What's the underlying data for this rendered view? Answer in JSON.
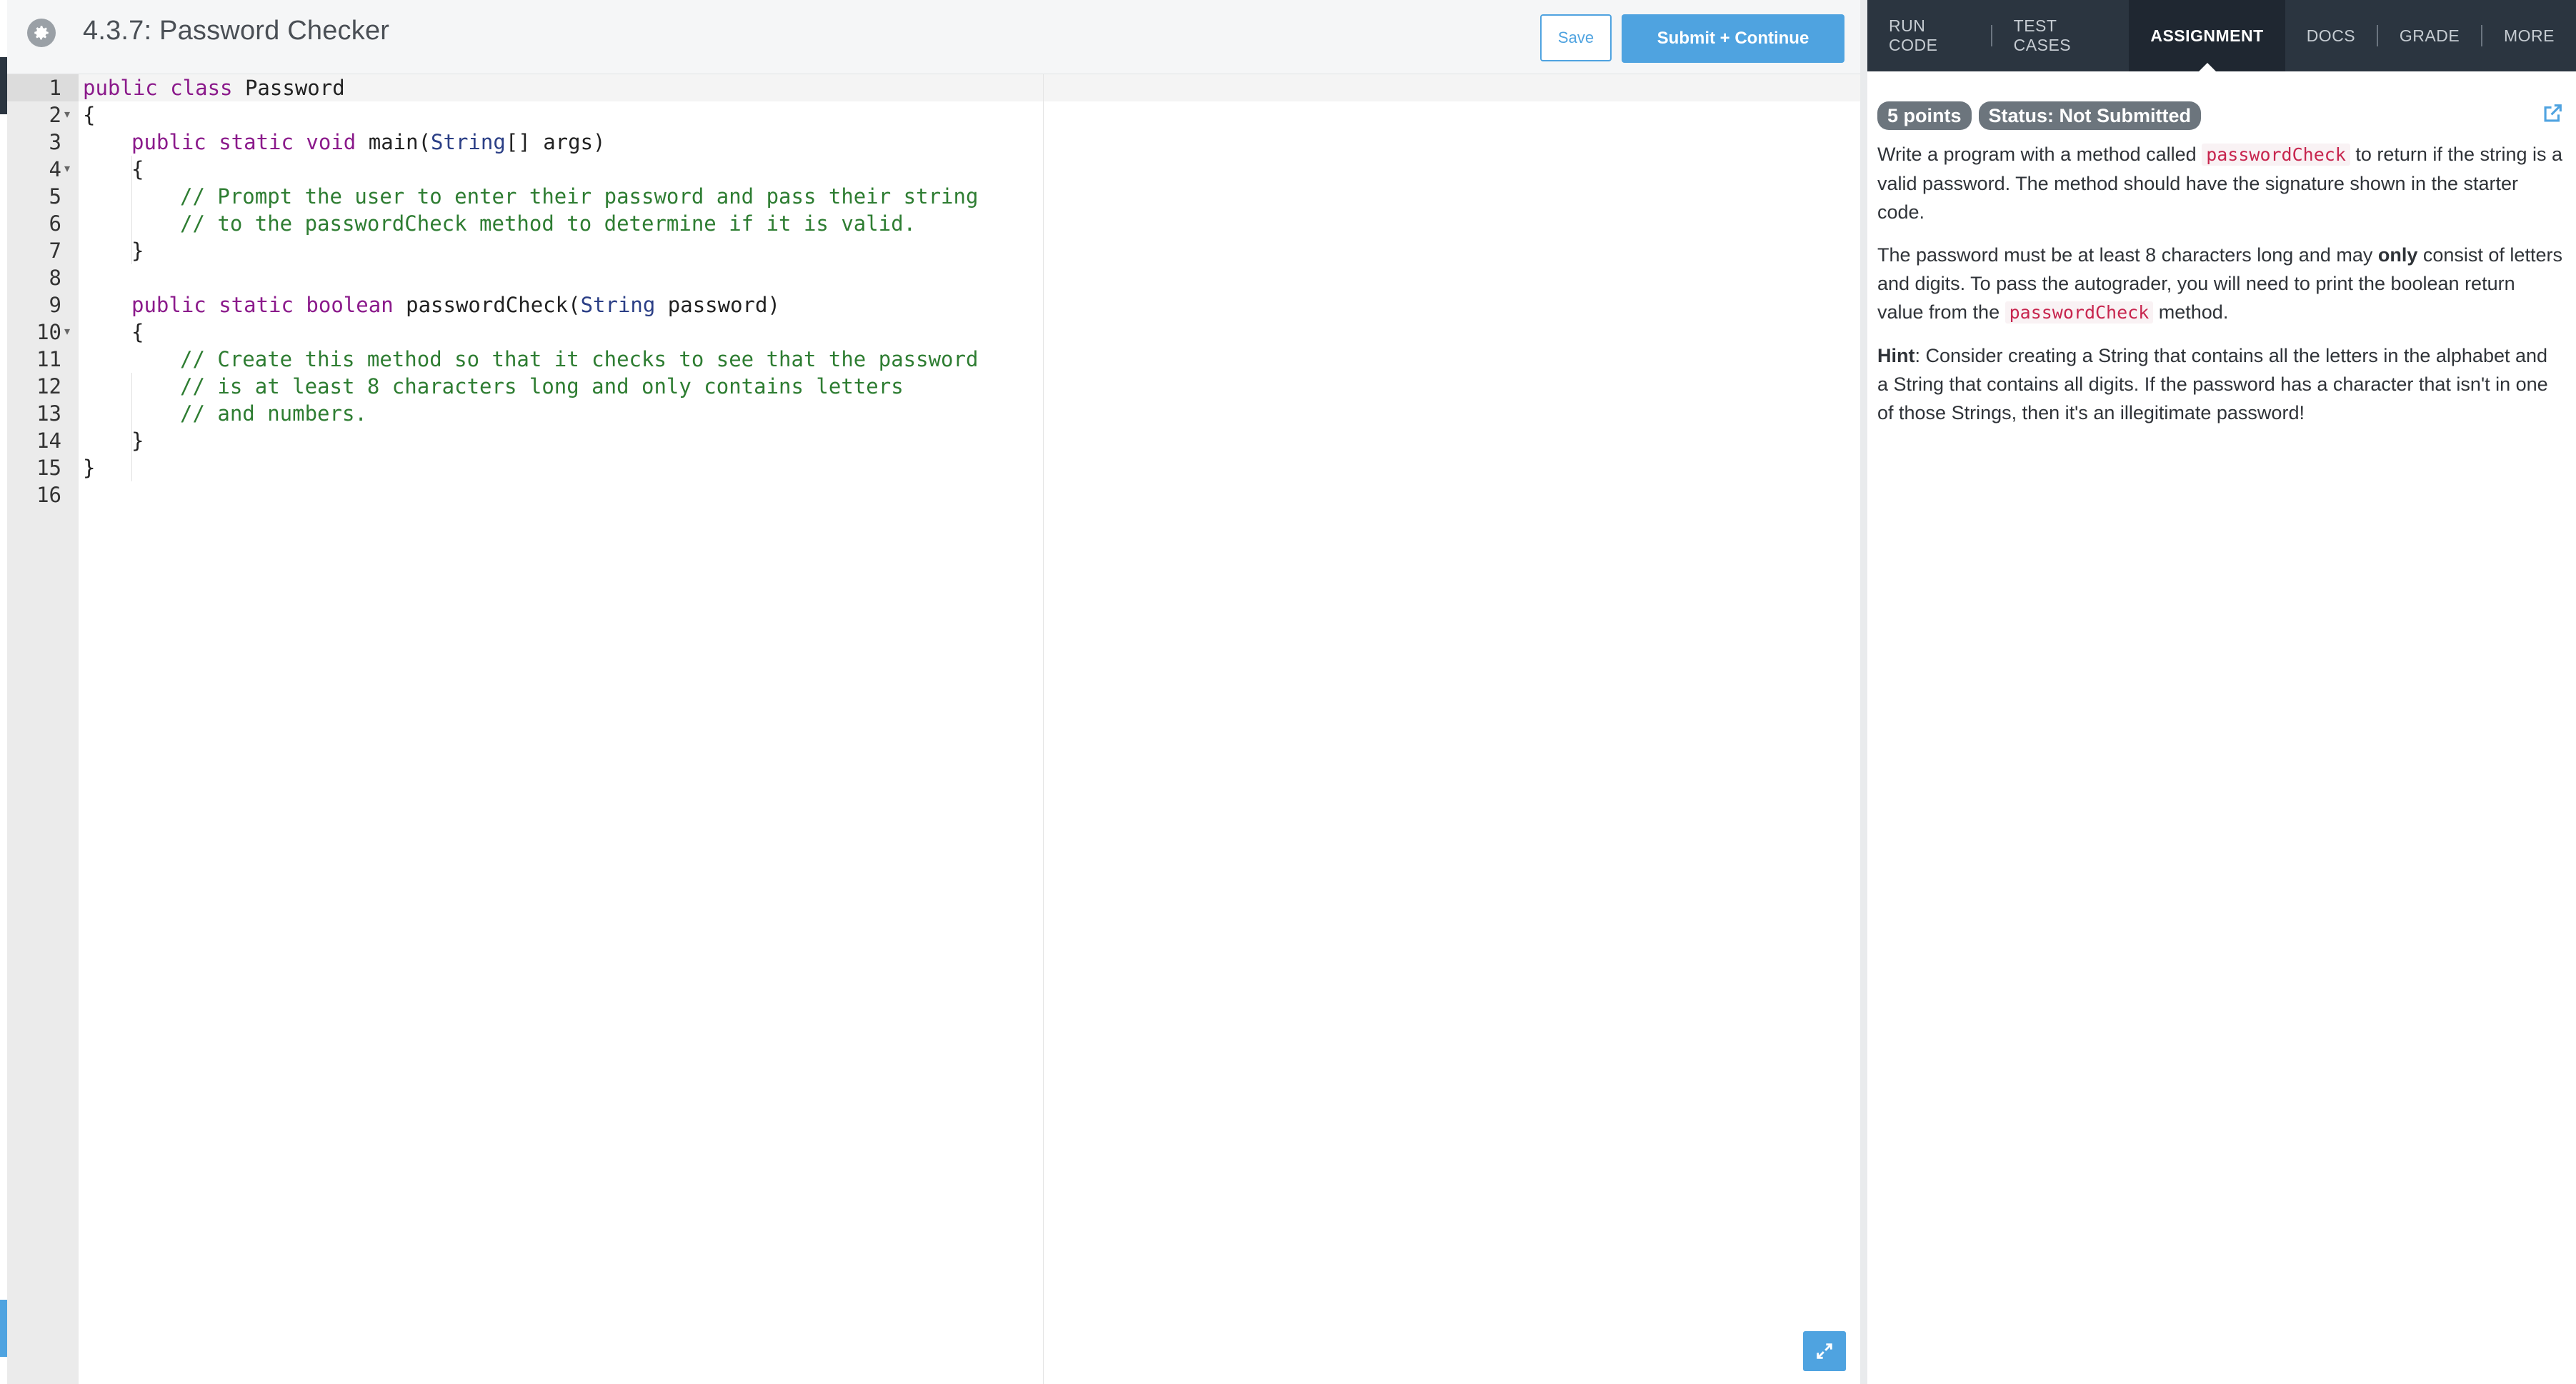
{
  "header": {
    "title": "4.3.7: Password Checker",
    "save_label": "Save",
    "submit_label": "Submit + Continue"
  },
  "editor": {
    "line_numbers": [
      "1",
      "2",
      "3",
      "4",
      "5",
      "6",
      "7",
      "8",
      "9",
      "10",
      "11",
      "12",
      "13",
      "14",
      "15",
      "16"
    ],
    "lines": {
      "l1a": "public class",
      "l1b": " Password",
      "l2": "{",
      "l3a": "public static void",
      "l3b": " main(",
      "l3c": "String",
      "l3d": "[] args)",
      "l4": "{",
      "l5": "// Prompt the user to enter their password and pass their string",
      "l6": "// to the passwordCheck method to determine if it is valid.",
      "l7": "}",
      "l9a": "public static boolean",
      "l9b": " passwordCheck(",
      "l9c": "String",
      "l9d": " password)",
      "l10": "{",
      "l11": "// Create this method so that it checks to see that the password",
      "l12": "// is at least 8 characters long and only contains letters",
      "l13": "// and numbers.",
      "l14": "}",
      "l15": "}"
    }
  },
  "tabs": [
    {
      "label": "RUN CODE"
    },
    {
      "label": "TEST CASES"
    },
    {
      "label": "ASSIGNMENT"
    },
    {
      "label": "DOCS"
    },
    {
      "label": "GRADE"
    },
    {
      "label": "MORE"
    }
  ],
  "assignment": {
    "points": "5 points",
    "status": "Status: Not Submitted",
    "p1_pre": "Write a program with a method called ",
    "p1_code": "passwordCheck",
    "p1_post": " to return if the string is a valid password. The method should have the signature shown in the starter code.",
    "p2_pre": "The password must be at least 8 characters long and may ",
    "p2_bold": "only",
    "p2_mid": " consist of letters and digits. To pass the autograder, you will need to print the boolean return value from the ",
    "p2_code": "passwordCheck",
    "p2_post": " method.",
    "p3_bold": "Hint",
    "p3_text": ": Consider creating a String that contains all the letters in the alphabet and a String that contains all digits. If the password has a character that isn't in one of those Strings, then it's an illegitimate password!"
  },
  "colors": {
    "accent": "#4fa3e0",
    "tabbar": "#2b3540",
    "badge": "#6c757d"
  }
}
